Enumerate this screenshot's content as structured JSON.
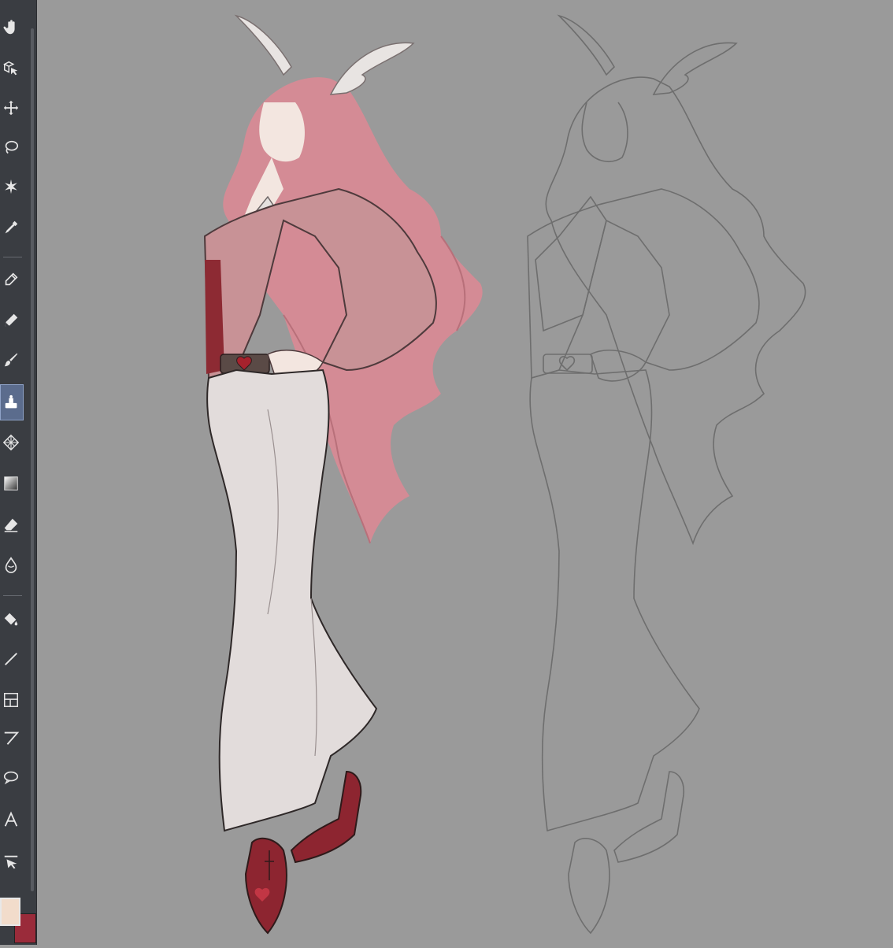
{
  "app": {
    "toolbar": {
      "tools": [
        {
          "name": "hand-icon",
          "active": false
        },
        {
          "name": "operation-icon",
          "active": false
        },
        {
          "name": "move-icon",
          "active": false
        },
        {
          "name": "lasso-icon",
          "active": false
        },
        {
          "name": "auto-select-icon",
          "active": false
        },
        {
          "name": "eyedropper-icon",
          "active": false
        },
        {
          "name": "pen-icon",
          "active": false
        },
        {
          "name": "pencil-icon",
          "active": false
        },
        {
          "name": "brush-icon",
          "active": false
        },
        {
          "name": "airbrush-icon",
          "active": true
        },
        {
          "name": "decoration-icon",
          "active": false
        },
        {
          "name": "gradient-icon",
          "active": false
        },
        {
          "name": "eraser-icon",
          "active": false
        },
        {
          "name": "blend-icon",
          "active": false
        },
        {
          "name": "fill-icon",
          "active": false
        },
        {
          "name": "line-icon",
          "active": false
        },
        {
          "name": "frame-icon",
          "active": false
        },
        {
          "name": "ruler-icon",
          "active": false
        },
        {
          "name": "balloon-icon",
          "active": false
        },
        {
          "name": "text-icon",
          "active": false
        },
        {
          "name": "correct-line-icon",
          "active": false
        }
      ]
    },
    "colors": {
      "main_color": "#f2dccb",
      "sub_color": "#9a2b3a",
      "canvas_bg": "#9a9a9a"
    },
    "artwork": {
      "left_figure": "colored",
      "right_figure": "lineart"
    }
  }
}
